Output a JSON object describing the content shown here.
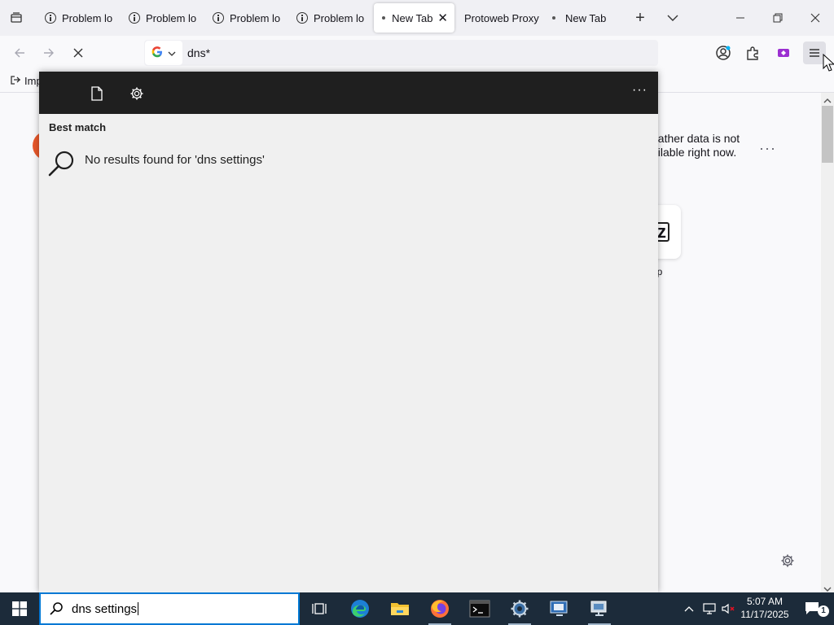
{
  "browser": {
    "tabs": [
      {
        "label": "Problem lo",
        "icon": "info-icon"
      },
      {
        "label": "Problem lo",
        "icon": "info-icon"
      },
      {
        "label": "Problem lo",
        "icon": "info-icon"
      },
      {
        "label": "Problem lo",
        "icon": "info-icon"
      },
      {
        "label": "New Tab",
        "icon": "dot-icon",
        "active": true
      },
      {
        "label": "Protoweb Proxy",
        "icon": ""
      },
      {
        "label": "New Tab",
        "icon": "dot-icon"
      }
    ],
    "url_text": "dns*",
    "bookmark_import": "Imp"
  },
  "newtab": {
    "weather_text": "eather data is not ailable right now.",
    "weather_line1": "eather data is not",
    "weather_line2": "ailable right now.",
    "shortcut_label": "ip",
    "shortcut_glyph": "z"
  },
  "search_panel": {
    "best_match_label": "Best match",
    "no_results_text": "No results found for 'dns settings'"
  },
  "taskbar": {
    "search_text": "dns settings",
    "time": "5:07 AM",
    "date": "11/17/2025",
    "notification_count": "1"
  },
  "colors": {
    "taskbar_bg": "#1c2b3a",
    "panel_top_bg": "#1f1f1f",
    "accent": "#0078d4"
  }
}
